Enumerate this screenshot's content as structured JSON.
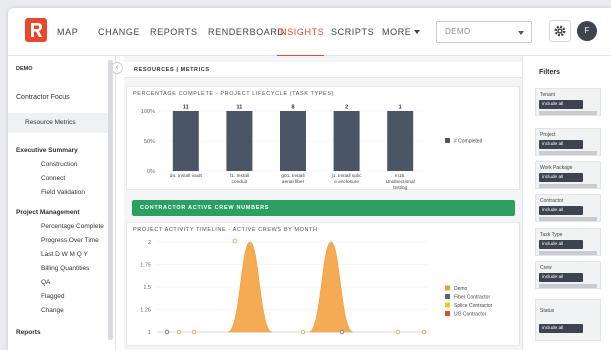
{
  "nav": {
    "items": [
      "MAP",
      "CHANGE",
      "REPORTS",
      "RENDERBOARD",
      "INSIGHTS",
      "SCRIPTS",
      "MORE"
    ],
    "active": "INSIGHTS",
    "selector_value": "DEMO",
    "avatar_initial": "F"
  },
  "sidebar": {
    "org": "DEMO",
    "contractor_focus": "Contractor Focus",
    "resource_metrics": "Resource Metrics",
    "executive_summary": "Executive Summary",
    "exec_items": [
      "Construction",
      "Connect",
      "Field Validation"
    ],
    "project_management": "Project Management",
    "pm_items": [
      "Percentage Complete",
      "Progress Over Time",
      "Last D W M Q Y",
      "Billing Quantities",
      "QA",
      "Flagged",
      "Change"
    ],
    "reports": "Reports"
  },
  "main": {
    "breadcrumb": "RESOURCES | METRICS",
    "pct_panel_title": "PERCENTAGE COMPLETE - PROJECT LIFECYCLE (TASK TYPES)",
    "green_bar": "CONTRACTOR ACTIVE CREW NUMBERS",
    "timeline_title": "PROJECT ACTIVITY TIMELINE - ACTIVE CREWS BY MONTH"
  },
  "chart_data": [
    {
      "type": "bar",
      "title": "PERCENTAGE COMPLETE - PROJECT LIFECYCLE (TASK TYPES)",
      "categories": [
        "d4. Install vault",
        "f1. Install conduit",
        "g01. Install aerial fiber",
        "j1. Install splic e enclosure",
        "m16. Unidirectional testing"
      ],
      "series": [
        {
          "name": "# Completed",
          "values": [
            100,
            100,
            100,
            100,
            100
          ]
        }
      ],
      "data_labels": [
        "11",
        "11",
        "8",
        "2",
        "1"
      ],
      "y_ticks": [
        "100%",
        "50%",
        "0%"
      ],
      "ylim": [
        0,
        100
      ],
      "legend": "right",
      "color": "#4a5565"
    },
    {
      "type": "area",
      "title": "PROJECT ACTIVITY TIMELINE - ACTIVE CREWS BY MONTH",
      "ylim": [
        1,
        2
      ],
      "y_ticks": [
        "2",
        "1.75",
        "1.5",
        "1.25",
        "1"
      ],
      "series": [
        {
          "name": "Demo",
          "color": "#f39c36"
        },
        {
          "name": "Fiber Contractor",
          "color": "#5d6470"
        },
        {
          "name": "Splice Contractor",
          "color": "#f4c51c"
        },
        {
          "name": "UG Contractor",
          "color": "#e8492c"
        }
      ],
      "legend": "right"
    }
  ],
  "filters": {
    "title": "Filters",
    "groups": [
      {
        "label": "Tenant",
        "value": "include all"
      },
      {
        "label": "Project",
        "value": "include all"
      },
      {
        "label": "Work Package",
        "value": "include all"
      },
      {
        "label": "Contractor",
        "value": "include all"
      },
      {
        "label": "Task Type",
        "value": "include all"
      },
      {
        "label": "Crew",
        "value": "include all"
      },
      {
        "label": "Status",
        "value": "include all"
      }
    ]
  }
}
